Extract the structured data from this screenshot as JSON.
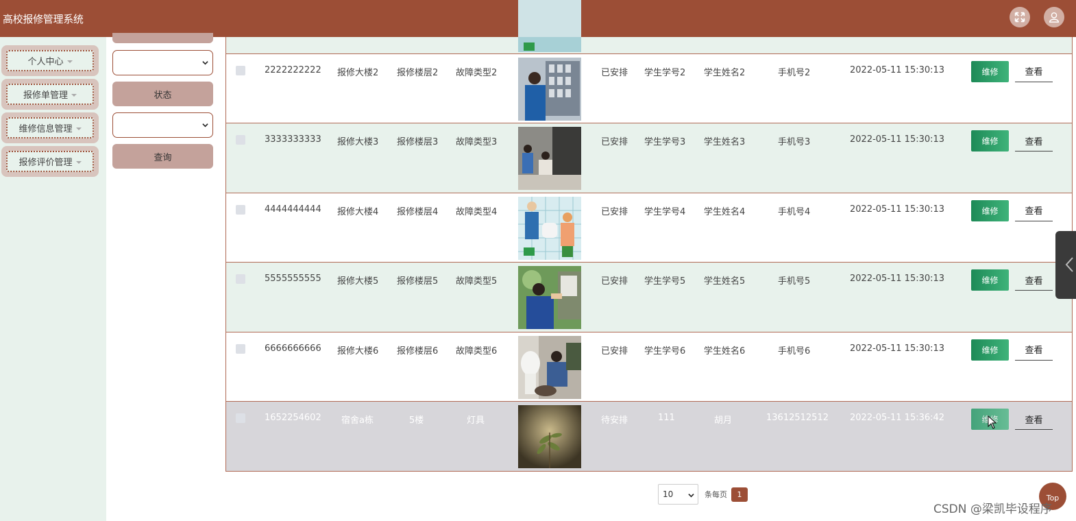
{
  "header": {
    "title": "高校报修管理系统"
  },
  "sidebar": {
    "items": [
      {
        "label": "个人中心"
      },
      {
        "label": "报修单管理"
      },
      {
        "label": "维修信息管理"
      },
      {
        "label": "报修评价管理"
      }
    ]
  },
  "filters": {
    "status_label": "状态",
    "query_label": "查询"
  },
  "table": {
    "repair_label": "维修",
    "view_label": "查看",
    "rows": [
      {
        "no": "2222222222",
        "building": "报修大楼2",
        "floor": "报修楼层2",
        "fault": "故障类型2",
        "status": "已安排",
        "student_id": "学生学号2",
        "student_name": "学生姓名2",
        "phone": "手机号2",
        "time": "2022-05-11 15:30:13"
      },
      {
        "no": "3333333333",
        "building": "报修大楼3",
        "floor": "报修楼层3",
        "fault": "故障类型3",
        "status": "已安排",
        "student_id": "学生学号3",
        "student_name": "学生姓名3",
        "phone": "手机号3",
        "time": "2022-05-11 15:30:13"
      },
      {
        "no": "4444444444",
        "building": "报修大楼4",
        "floor": "报修楼层4",
        "fault": "故障类型4",
        "status": "已安排",
        "student_id": "学生学号4",
        "student_name": "学生姓名4",
        "phone": "手机号4",
        "time": "2022-05-11 15:30:13"
      },
      {
        "no": "5555555555",
        "building": "报修大楼5",
        "floor": "报修楼层5",
        "fault": "故障类型5",
        "status": "已安排",
        "student_id": "学生学号5",
        "student_name": "学生姓名5",
        "phone": "手机号5",
        "time": "2022-05-11 15:30:13"
      },
      {
        "no": "6666666666",
        "building": "报修大楼6",
        "floor": "报修楼层6",
        "fault": "故障类型6",
        "status": "已安排",
        "student_id": "学生学号6",
        "student_name": "学生姓名6",
        "phone": "手机号6",
        "time": "2022-05-11 15:30:13"
      },
      {
        "no": "1652254602",
        "building": "宿舍a栋",
        "floor": "5楼",
        "fault": "灯具",
        "status": "待安排",
        "student_id": "111",
        "student_name": "胡月",
        "phone": "13612512512",
        "time": "2022-05-11 15:36:42"
      }
    ]
  },
  "pagination": {
    "page_size": "10",
    "per_page_label": "条每页",
    "current_page": "1"
  },
  "top_button": "Top",
  "watermark": "CSDN @梁凯毕设程序",
  "colors": {
    "primary": "#9c4e36",
    "row_alt": "#e8f2ec",
    "repair_button": "#1d8a57"
  }
}
